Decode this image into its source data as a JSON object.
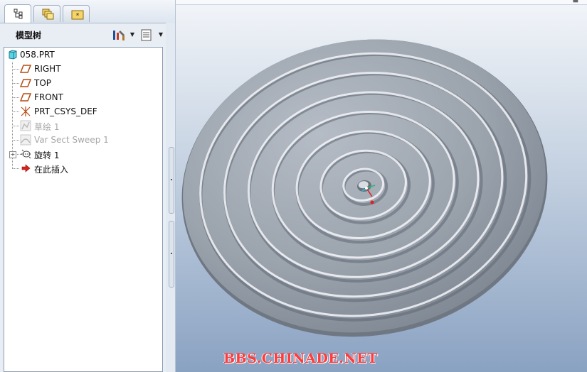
{
  "tabs": [
    {
      "icon": "model-tree-icon",
      "active": true
    },
    {
      "icon": "folder-browser-icon",
      "active": false
    },
    {
      "icon": "favorites-icon",
      "active": false
    }
  ],
  "model_tree": {
    "title": "模型树",
    "settings_icon": "tree-settings-icon",
    "columns_icon": "tree-columns-icon",
    "items": [
      {
        "label": "058.PRT",
        "icon": "part-icon",
        "dim": false
      },
      {
        "label": "RIGHT",
        "icon": "datum-plane-icon",
        "dim": false
      },
      {
        "label": "TOP",
        "icon": "datum-plane-icon",
        "dim": false
      },
      {
        "label": "FRONT",
        "icon": "datum-plane-icon",
        "dim": false
      },
      {
        "label": "PRT_CSYS_DEF",
        "icon": "coordinate-system-icon",
        "dim": false
      },
      {
        "label": "草绘 1",
        "icon": "sketch-icon",
        "dim": true
      },
      {
        "label": "Var Sect Sweep 1",
        "icon": "sweep-icon",
        "dim": true
      },
      {
        "label": "旋转 1",
        "icon": "revolve-icon",
        "dim": false
      },
      {
        "label": "在此插入",
        "icon": "insert-here-arrow-icon",
        "dim": false
      }
    ]
  },
  "viewport": {
    "watermark": "BBS.CHINADE.NET"
  },
  "colors": {
    "accent_red": "#ff3b3b",
    "datum_plane": "#c0561a",
    "model_gray": "#9ba3ad"
  }
}
